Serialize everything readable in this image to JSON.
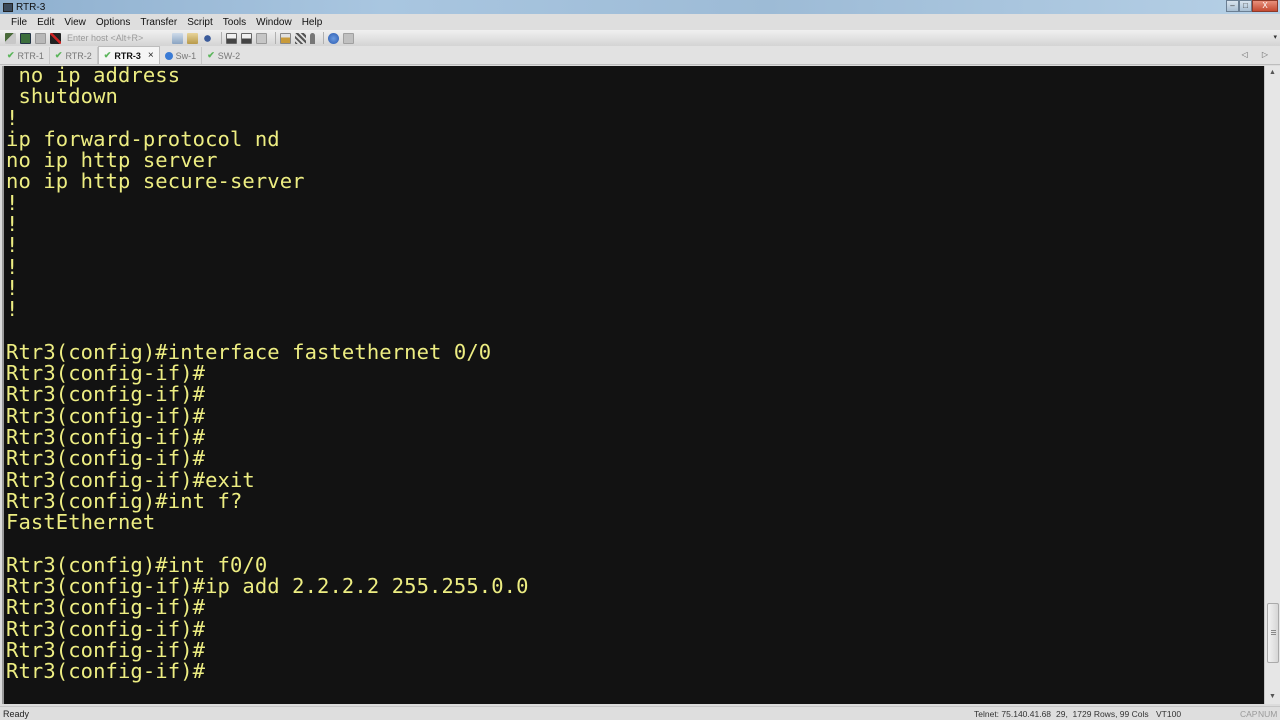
{
  "window": {
    "title": "RTR-3",
    "controls": {
      "minimize": "–",
      "maximize": "□",
      "close": "X"
    }
  },
  "menu": [
    "File",
    "Edit",
    "View",
    "Options",
    "Transfer",
    "Script",
    "Tools",
    "Window",
    "Help"
  ],
  "toolbar": {
    "host_placeholder": "Enter host <Alt+R>",
    "icons_left": [
      "connect-icon",
      "quick-connect-icon",
      "reconnect-icon",
      "disconnect-icon"
    ],
    "icons_right": [
      "copy-icon",
      "paste-icon",
      "find-icon",
      "print-icon",
      "print-selection-icon",
      "print-screen-icon",
      "session-options-icon",
      "global-options-icon",
      "key-icon",
      "help-icon",
      "sftp-icon"
    ]
  },
  "tabs": [
    {
      "label": "RTR-1",
      "status": "connected",
      "active": false
    },
    {
      "label": "RTR-2",
      "status": "connected",
      "active": false
    },
    {
      "label": "RTR-3",
      "status": "connected",
      "active": true,
      "close": "×"
    },
    {
      "label": "Sw-1",
      "status": "info",
      "active": false
    },
    {
      "label": "SW-2",
      "status": "connected",
      "active": false
    }
  ],
  "tab_nav": "◁ ▷",
  "terminal": {
    "text_color": "#eded82",
    "background": "#121212",
    "lines": [
      " no ip address",
      " shutdown",
      "!",
      "ip forward-protocol nd",
      "no ip http server",
      "no ip http secure-server",
      "!",
      "!",
      "!",
      "!",
      "!",
      "!",
      "",
      "Rtr3(config)#interface fastethernet 0/0",
      "Rtr3(config-if)#",
      "Rtr3(config-if)#",
      "Rtr3(config-if)#",
      "Rtr3(config-if)#",
      "Rtr3(config-if)#",
      "Rtr3(config-if)#exit",
      "Rtr3(config)#int f?",
      "FastEthernet",
      "",
      "Rtr3(config)#int f0/0",
      "Rtr3(config-if)#ip add 2.2.2.2 255.255.0.0",
      "Rtr3(config-if)#",
      "Rtr3(config-if)#",
      "Rtr3(config-if)#",
      "Rtr3(config-if)#"
    ]
  },
  "scrollbar": {
    "up": "▲",
    "down": "▼",
    "position_fraction": 0.95
  },
  "status": {
    "ready": "Ready",
    "connection": "Telnet: 75.140.41.68",
    "cursor": "29,  17",
    "size": "29 Rows, 99 Cols",
    "emulation": "VT100",
    "caps": "CAP",
    "num": "NUM"
  }
}
